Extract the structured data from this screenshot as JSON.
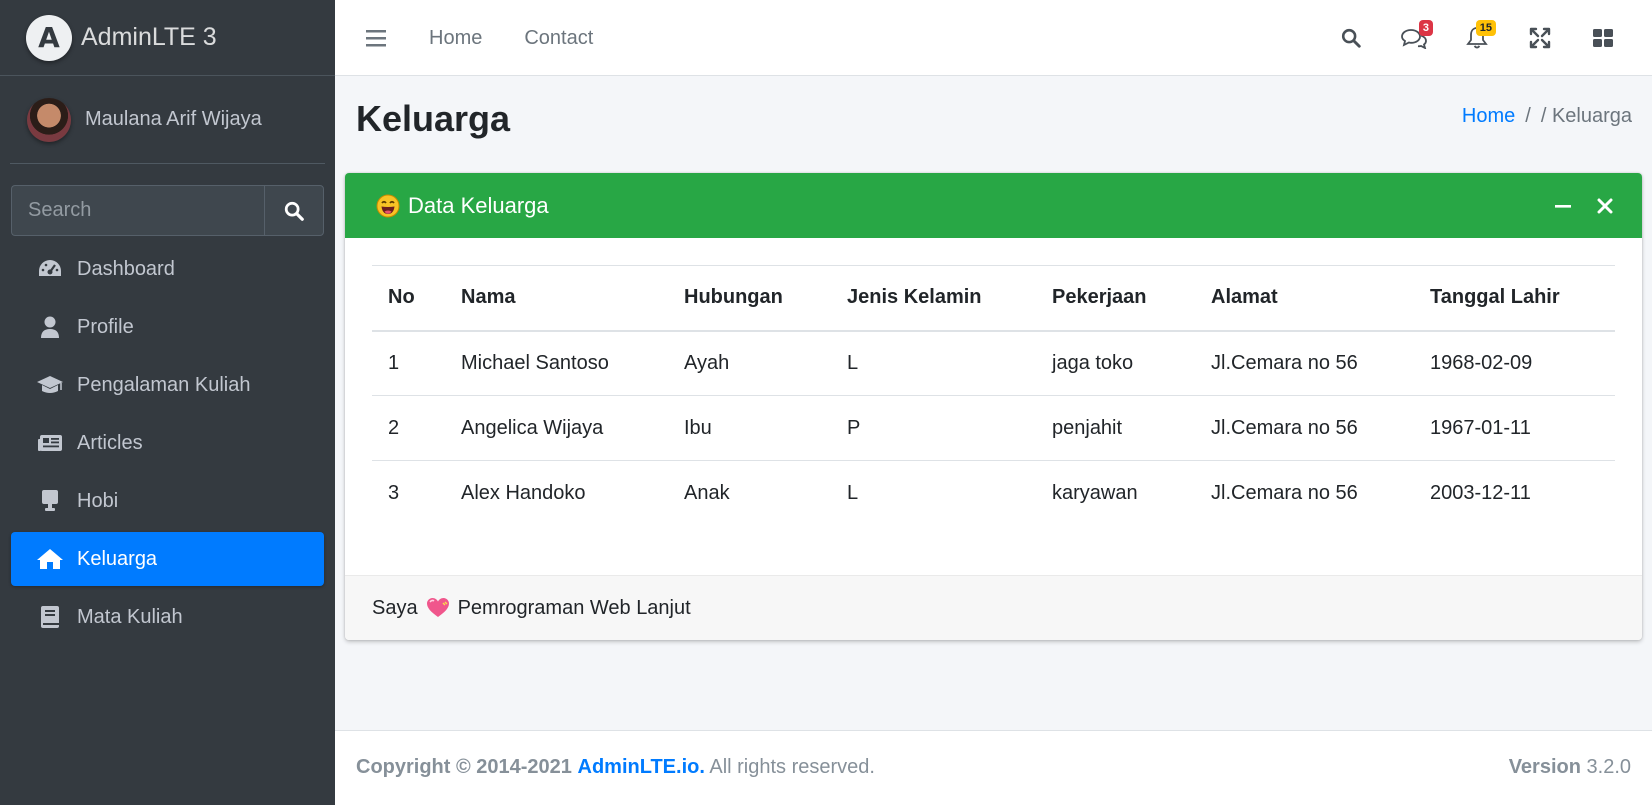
{
  "brand": {
    "name": "AdminLTE 3",
    "logo_letter": "A"
  },
  "user": {
    "name": "Maulana Arif Wijaya"
  },
  "sidebar_search": {
    "placeholder": "Search"
  },
  "sidebar": {
    "items": [
      {
        "label": "Dashboard",
        "icon": "tachometer-icon"
      },
      {
        "label": "Profile",
        "icon": "user-icon"
      },
      {
        "label": "Pengalaman Kuliah",
        "icon": "graduation-cap-icon"
      },
      {
        "label": "Articles",
        "icon": "newspaper-icon"
      },
      {
        "label": "Hobi",
        "icon": "desktop-icon"
      },
      {
        "label": "Keluarga",
        "icon": "home-icon",
        "active": true
      },
      {
        "label": "Mata Kuliah",
        "icon": "book-icon"
      }
    ]
  },
  "topnav": {
    "links": [
      "Home",
      "Contact"
    ],
    "messages_count": "3",
    "notifications_count": "15"
  },
  "page": {
    "title": "Keluarga",
    "breadcrumb": {
      "home": "Home",
      "separator": "/",
      "current": "/ Keluarga"
    }
  },
  "card": {
    "title": "Data Keluarga",
    "header_color": "#28a745",
    "columns": [
      "No",
      "Nama",
      "Hubungan",
      "Jenis Kelamin",
      "Pekerjaan",
      "Alamat",
      "Tanggal Lahir"
    ],
    "rows": [
      [
        "1",
        "Michael Santoso",
        "Ayah",
        "L",
        "jaga toko",
        "Jl.Cemara no 56",
        "1968-02-09"
      ],
      [
        "2",
        "Angelica Wijaya",
        "Ibu",
        "P",
        "penjahit",
        "Jl.Cemara no 56",
        "1967-01-11"
      ],
      [
        "3",
        "Alex Handoko",
        "Anak",
        "L",
        "karyawan",
        "Jl.Cemara no 56",
        "2003-12-11"
      ]
    ],
    "footer_before": "Saya",
    "footer_after": "Pemrograman Web Lanjut"
  },
  "footer": {
    "copyright": "Copyright © 2014-2021",
    "brand_link": "AdminLTE.io.",
    "rights": "All rights reserved.",
    "version_label": "Version",
    "version": "3.2.0"
  },
  "colors": {
    "sidebar_bg": "#343a40",
    "active": "#007bff",
    "link": "#007bff"
  }
}
